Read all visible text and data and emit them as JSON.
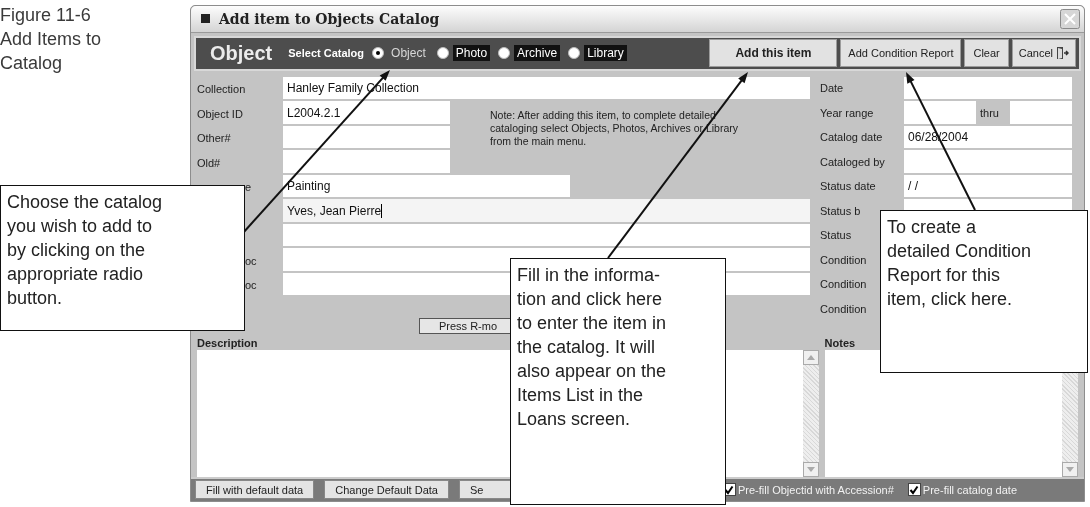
{
  "caption": [
    "Figure 11-6",
    "Add Items to",
    "Catalog"
  ],
  "window": {
    "title": "Add item to Objects Catalog"
  },
  "toolbar": {
    "heading": "Object",
    "select_label": "Select Catalog",
    "catalogs": [
      {
        "label": "Object",
        "selected": true
      },
      {
        "label": "Photo",
        "selected": false
      },
      {
        "label": "Archive",
        "selected": false
      },
      {
        "label": "Library",
        "selected": false
      }
    ],
    "buttons": [
      {
        "label": "Add this item",
        "kind": "primary"
      },
      {
        "label": "Add Condition Report",
        "kind": "normal"
      },
      {
        "label": "Clear",
        "kind": "normal"
      },
      {
        "label": "Cancel",
        "kind": "exit"
      }
    ]
  },
  "left_fields": [
    {
      "label": "Collection",
      "value": "Hanley Family Collection",
      "kind": "wide",
      "clipped": false,
      "focused": false
    },
    {
      "label": "Object ID",
      "value": "L2004.2.1",
      "kind": "short",
      "clipped": false,
      "focused": false
    },
    {
      "label": "Other#",
      "kind": "short",
      "clipped": false,
      "focused": false
    },
    {
      "label": "Old#",
      "kind": "short",
      "clipped": false,
      "focused": false
    },
    {
      "label": "e",
      "value": "Painting",
      "kind": "medium",
      "clipped": true,
      "focused": false
    },
    {
      "value": "Yves, Jean Pierre",
      "kind": "wide",
      "focused": true
    },
    {
      "kind": "wide",
      "focused": false
    },
    {
      "label": "oc",
      "kind": "wide",
      "clipped": true,
      "focused": false
    },
    {
      "label": "oc",
      "kind": "wide",
      "clipped": true,
      "focused": false
    }
  ],
  "note": "Note: After adding this item, to complete detailed cataloging select Objects, Photos, Archives or Library from the main menu.",
  "right_fields": [
    {
      "label": "Date",
      "kind": "field"
    },
    {
      "label": "Year range",
      "kind": "range",
      "thru": "thru"
    },
    {
      "label": "Catalog date",
      "kind": "field",
      "value": "06/28/2004"
    },
    {
      "label": "Cataloged by",
      "kind": "field"
    },
    {
      "label": "Status date",
      "kind": "field",
      "value": "/ /"
    },
    {
      "label": "Status b",
      "kind": "field"
    },
    {
      "label": "Status",
      "kind": "covered"
    },
    {
      "label": "Condition",
      "kind": "covered"
    },
    {
      "label": "Condition",
      "kind": "covered"
    },
    {
      "label": "Condition",
      "kind": "covered"
    }
  ],
  "press_button": "Press R-mo",
  "description_label": "Description",
  "notes_label": "Notes",
  "bottom_buttons": [
    "Fill with default data",
    "Change Default Data",
    "Se"
  ],
  "checkboxes": [
    {
      "label": "Pre-fill Objectid with Accession#",
      "checked": true
    },
    {
      "label": "Pre-fill catalog date",
      "checked": true
    }
  ],
  "callouts": [
    {
      "lines": [
        "Choose the catalog",
        "you wish to add to",
        "by clicking on the",
        "appropriate radio",
        "button."
      ]
    },
    {
      "lines": [
        "Fill in the informa-",
        "tion and click here",
        "to enter the item in",
        "the catalog. It will",
        "also appear on the",
        "Items List in the",
        "Loans screen."
      ]
    },
    {
      "lines": [
        "To create a",
        "detailed Condition",
        "Report for this",
        "item, click here."
      ]
    }
  ]
}
